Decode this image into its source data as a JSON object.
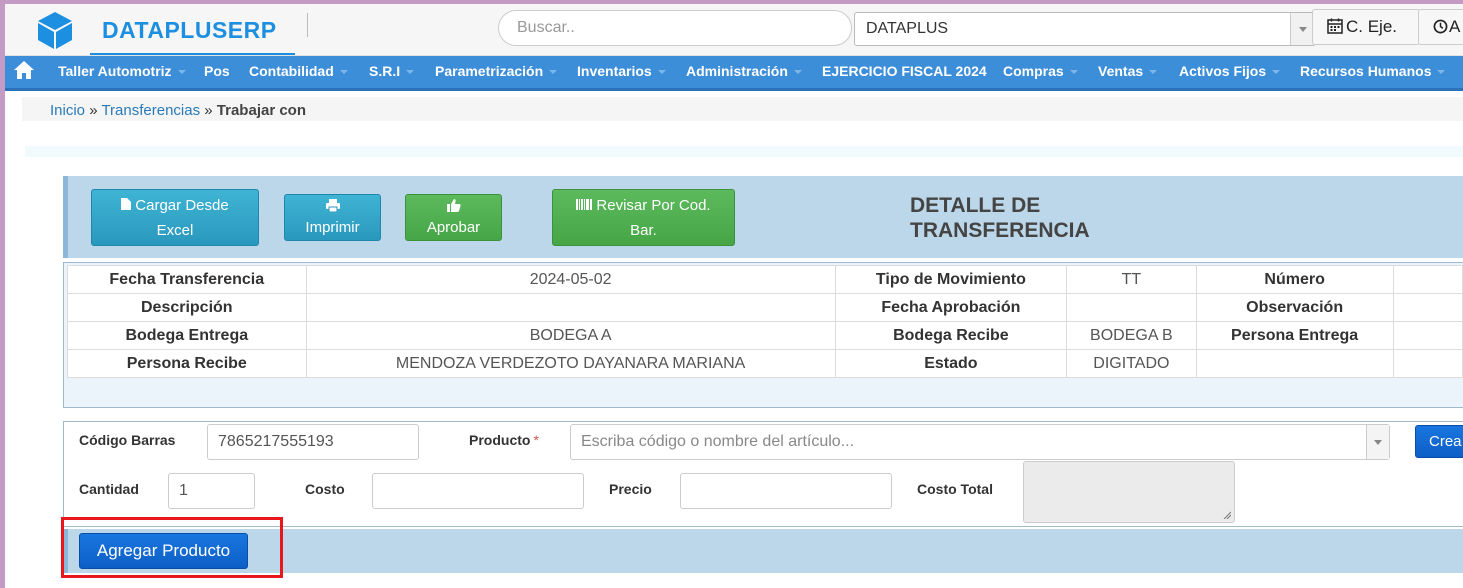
{
  "header": {
    "brand": "DATAPLUSERP",
    "search_placeholder": "Buscar..",
    "company": "DATAPLUS",
    "ceje_label": "C. Eje.",
    "user_btn_label": "A"
  },
  "nav": {
    "items": [
      "Taller Automotriz",
      "Pos",
      "Contabilidad",
      "S.R.I",
      "Parametrización",
      "Inventarios",
      "Administración",
      "EJERCICIO FISCAL 2024",
      "Compras",
      "Ventas",
      "Activos Fijos",
      "Recursos Humanos"
    ]
  },
  "breadcrumb": {
    "home": "Inicio",
    "sep": "»",
    "section": "Transferencias",
    "current": "Trabajar con"
  },
  "toolbar": {
    "cargar_line1": "Cargar Desde",
    "cargar_line2": "Excel",
    "imprimir": "Imprimir",
    "aprobar": "Aprobar",
    "revisar_line1": "Revisar Por Cod.",
    "revisar_line2": "Bar.",
    "title_line1": "DETALLE DE",
    "title_line2": "TRANSFERENCIA"
  },
  "info": {
    "rows": [
      [
        {
          "label": "Fecha Transferencia",
          "value": "2024-05-02"
        },
        {
          "label": "Tipo de Movimiento",
          "value": "TT"
        },
        {
          "label": "Número",
          "value": ""
        }
      ],
      [
        {
          "label": "Descripción",
          "value": ""
        },
        {
          "label": "Fecha Aprobación",
          "value": ""
        },
        {
          "label": "Observación",
          "value": ""
        }
      ],
      [
        {
          "label": "Bodega Entrega",
          "value": "BODEGA A"
        },
        {
          "label": "Bodega Recibe",
          "value": "BODEGA B"
        },
        {
          "label": "Persona Entrega",
          "value": ""
        }
      ],
      [
        {
          "label": "Persona Recibe",
          "value": "MENDOZA VERDEZOTO DAYANARA MARIANA"
        },
        {
          "label": "Estado",
          "value": "DIGITADO"
        },
        {
          "label": "",
          "value": ""
        }
      ]
    ]
  },
  "form": {
    "codigo_label": "Código Barras",
    "codigo_value": "7865217555193",
    "producto_label": "Producto",
    "required_mark": "*",
    "producto_placeholder": "Escriba código o nombre del artículo...",
    "crear_label": "Crea",
    "cantidad_label": "Cantidad",
    "cantidad_value": "1",
    "costo_label": "Costo",
    "precio_label": "Precio",
    "costo_total_label": "Costo Total"
  },
  "actions": {
    "agregar": "Agregar Producto"
  },
  "colors": {
    "brand": "#1d8fe0",
    "nav": "#3d8ed8",
    "panel": "#bcd7e9",
    "highlight": "#e8171b"
  }
}
